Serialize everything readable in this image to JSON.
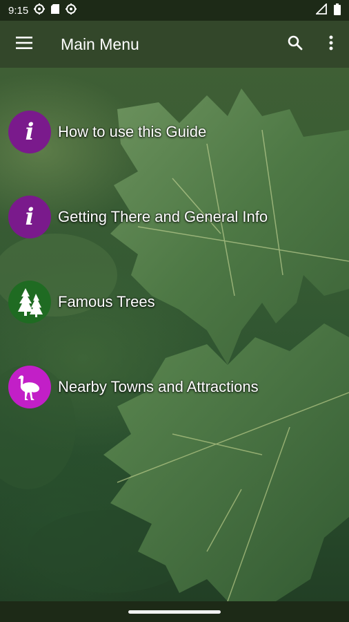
{
  "status_bar": {
    "time": "9:15",
    "left_icons": [
      "gps-icon",
      "sd-card-icon",
      "gps-icon"
    ],
    "right_icons": [
      "signal-icon",
      "battery-icon"
    ]
  },
  "app_bar": {
    "title": "Main Menu",
    "menu_icon": "hamburger-menu-icon",
    "search_icon": "search-icon",
    "overflow_icon": "more-vert-icon"
  },
  "menu": {
    "items": [
      {
        "label": "How to use this Guide",
        "icon": "info-icon",
        "icon_color": "#7a1a8c"
      },
      {
        "label": "Getting There and General Info",
        "icon": "info-icon",
        "icon_color": "#7a1a8c"
      },
      {
        "label": "Famous Trees",
        "icon": "trees-icon",
        "icon_color": "#1f6b22"
      },
      {
        "label": "Nearby Towns and Attractions",
        "icon": "emu-icon",
        "icon_color": "#c21fc7"
      }
    ]
  },
  "colors": {
    "status_bar": "#1d2a17",
    "app_bar": "#33472a",
    "nav_bar": "#1d2a17"
  }
}
